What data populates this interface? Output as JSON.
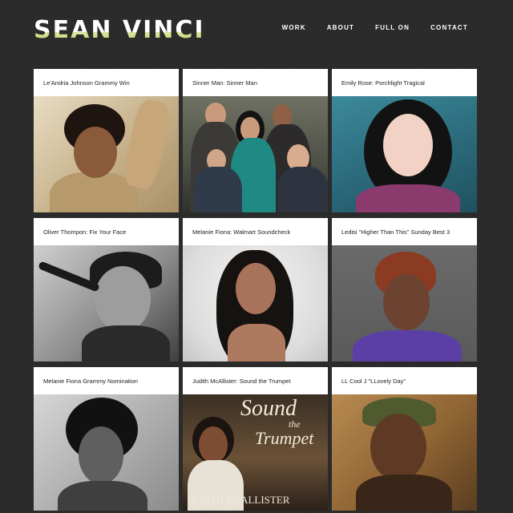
{
  "site": {
    "logo": "SEAN VINCI"
  },
  "nav": {
    "items": [
      {
        "label": "WORK"
      },
      {
        "label": "ABOUT"
      },
      {
        "label": "FULL ON"
      },
      {
        "label": "CONTACT"
      }
    ]
  },
  "cards": [
    {
      "title": "Le'Andria Johnson Grammy Win",
      "photo_icon": "portrait-photo"
    },
    {
      "title": "Sinner Man: Sinner Man",
      "photo_icon": "band-photo"
    },
    {
      "title": "Emily Rose: Porchlight Tragical",
      "photo_icon": "portrait-photo"
    },
    {
      "title": "Oliver Thompon: Fix Your Face",
      "photo_icon": "singer-photo"
    },
    {
      "title": "Melanie Fiona: Walmart Soundcheck",
      "photo_icon": "portrait-photo"
    },
    {
      "title": "Ledisi \"Higher Than This\" Sunday Best 3",
      "photo_icon": "portrait-photo"
    },
    {
      "title": "Melanie Fiona Grammy Nomination",
      "photo_icon": "portrait-photo"
    },
    {
      "title": "Judith McAllister: Sound the Trumpet",
      "photo_icon": "album-cover"
    },
    {
      "title": "LL Cool J \"LLovely Day\"",
      "photo_icon": "portrait-photo"
    }
  ],
  "album": {
    "sound": "Sound",
    "the": "the",
    "trumpet": "Trumpet",
    "artist": "JUDITH McALLISTER"
  },
  "colors": {
    "background": "#2a2a2a",
    "card_title_bg": "#ffffff",
    "logo_accent": "#b9d05a"
  }
}
